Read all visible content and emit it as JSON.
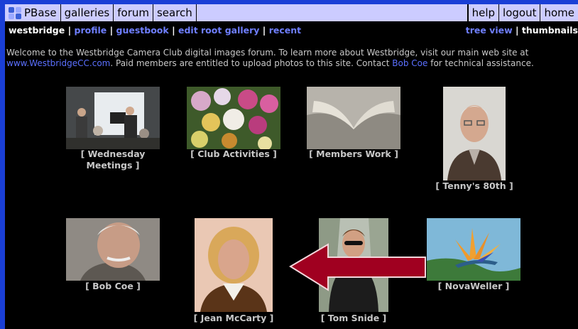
{
  "menubar": {
    "logo_label": "PBase",
    "left_items": [
      "galleries",
      "forum",
      "search"
    ],
    "right_items": [
      "help",
      "logout",
      "home"
    ]
  },
  "nav": {
    "user": "westbridge",
    "links": [
      "profile",
      "guestbook",
      "edit root gallery",
      "recent"
    ],
    "tree_view": "tree view",
    "thumbnails": "thumbnails"
  },
  "intro": {
    "part1": "Welcome to the Westbridge Camera Club digital images forum. To learn more about Westbridge, visit our main web site at",
    "site_link": "www.WestbridgeCC.com",
    "part2": ". Paid members are entitled to upload photos to this site. Contact ",
    "contact_link": "Bob Coe",
    "part3": " for technical assistance."
  },
  "galleries": [
    {
      "caption": "[ Wednesday Meetings ]"
    },
    {
      "caption": "[ Club Activities ]"
    },
    {
      "caption": "[ Members Work ]"
    },
    {
      "caption": "[ Tenny's 80th ]"
    },
    {
      "caption": "[ Bob Coe ]"
    },
    {
      "caption": "[ Jean McCarty ]"
    },
    {
      "caption": "[ Tom Snide ]"
    },
    {
      "caption": "[ NovaWeller ]"
    }
  ],
  "colors": {
    "frame": "#1a3fd6",
    "menubar": "#ccccff",
    "link": "#6f7fff",
    "arrow": "#a00020"
  }
}
